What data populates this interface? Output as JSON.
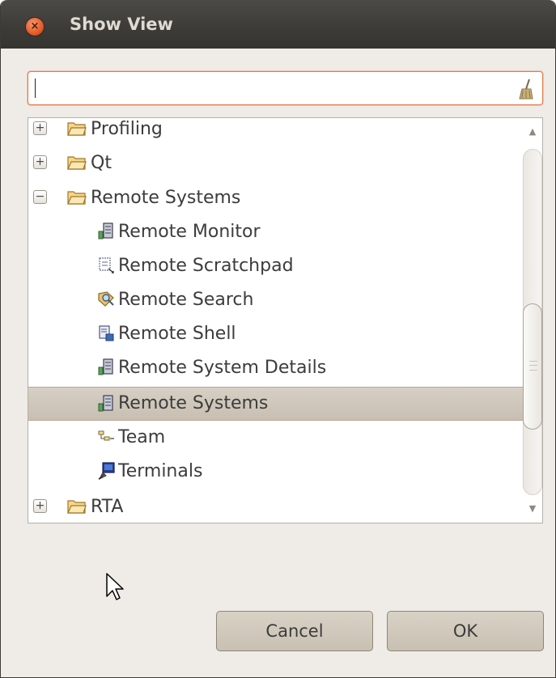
{
  "dialog": {
    "title": "Show View",
    "close_glyph": "×"
  },
  "search": {
    "value": "",
    "icon": "broom-icon"
  },
  "tree": {
    "items": [
      {
        "label": "Profiling",
        "type": "folder",
        "expander": "+",
        "expanded": false
      },
      {
        "label": "Qt",
        "type": "folder",
        "expander": "+",
        "expanded": false
      },
      {
        "label": "Remote Systems",
        "type": "folder",
        "expander": "−",
        "expanded": true
      },
      {
        "label": "Remote Monitor",
        "type": "view",
        "icon": "remote-systems-icon"
      },
      {
        "label": "Remote Scratchpad",
        "type": "view",
        "icon": "scratchpad-icon"
      },
      {
        "label": "Remote Search",
        "type": "view",
        "icon": "search-icon"
      },
      {
        "label": "Remote Shell",
        "type": "view",
        "icon": "shell-icon"
      },
      {
        "label": "Remote System Details",
        "type": "view",
        "icon": "remote-systems-icon"
      },
      {
        "label": "Remote Systems",
        "type": "view",
        "icon": "remote-systems-icon",
        "selected": true
      },
      {
        "label": "Team",
        "type": "view",
        "icon": "team-icon"
      },
      {
        "label": "Terminals",
        "type": "view",
        "icon": "terminal-icon"
      },
      {
        "label": "RTA",
        "type": "folder",
        "expander": "+",
        "expanded": false
      }
    ],
    "scroll_arrow_up": "▲",
    "scroll_arrow_down": "▼"
  },
  "buttons": {
    "cancel": "Cancel",
    "ok": "OK"
  },
  "colors": {
    "titlebar": "#3c3b37",
    "dialog_bg": "#efebe7",
    "selection": "#cfc7bb",
    "close": "#e45a27",
    "focus": "#e07b4c"
  }
}
